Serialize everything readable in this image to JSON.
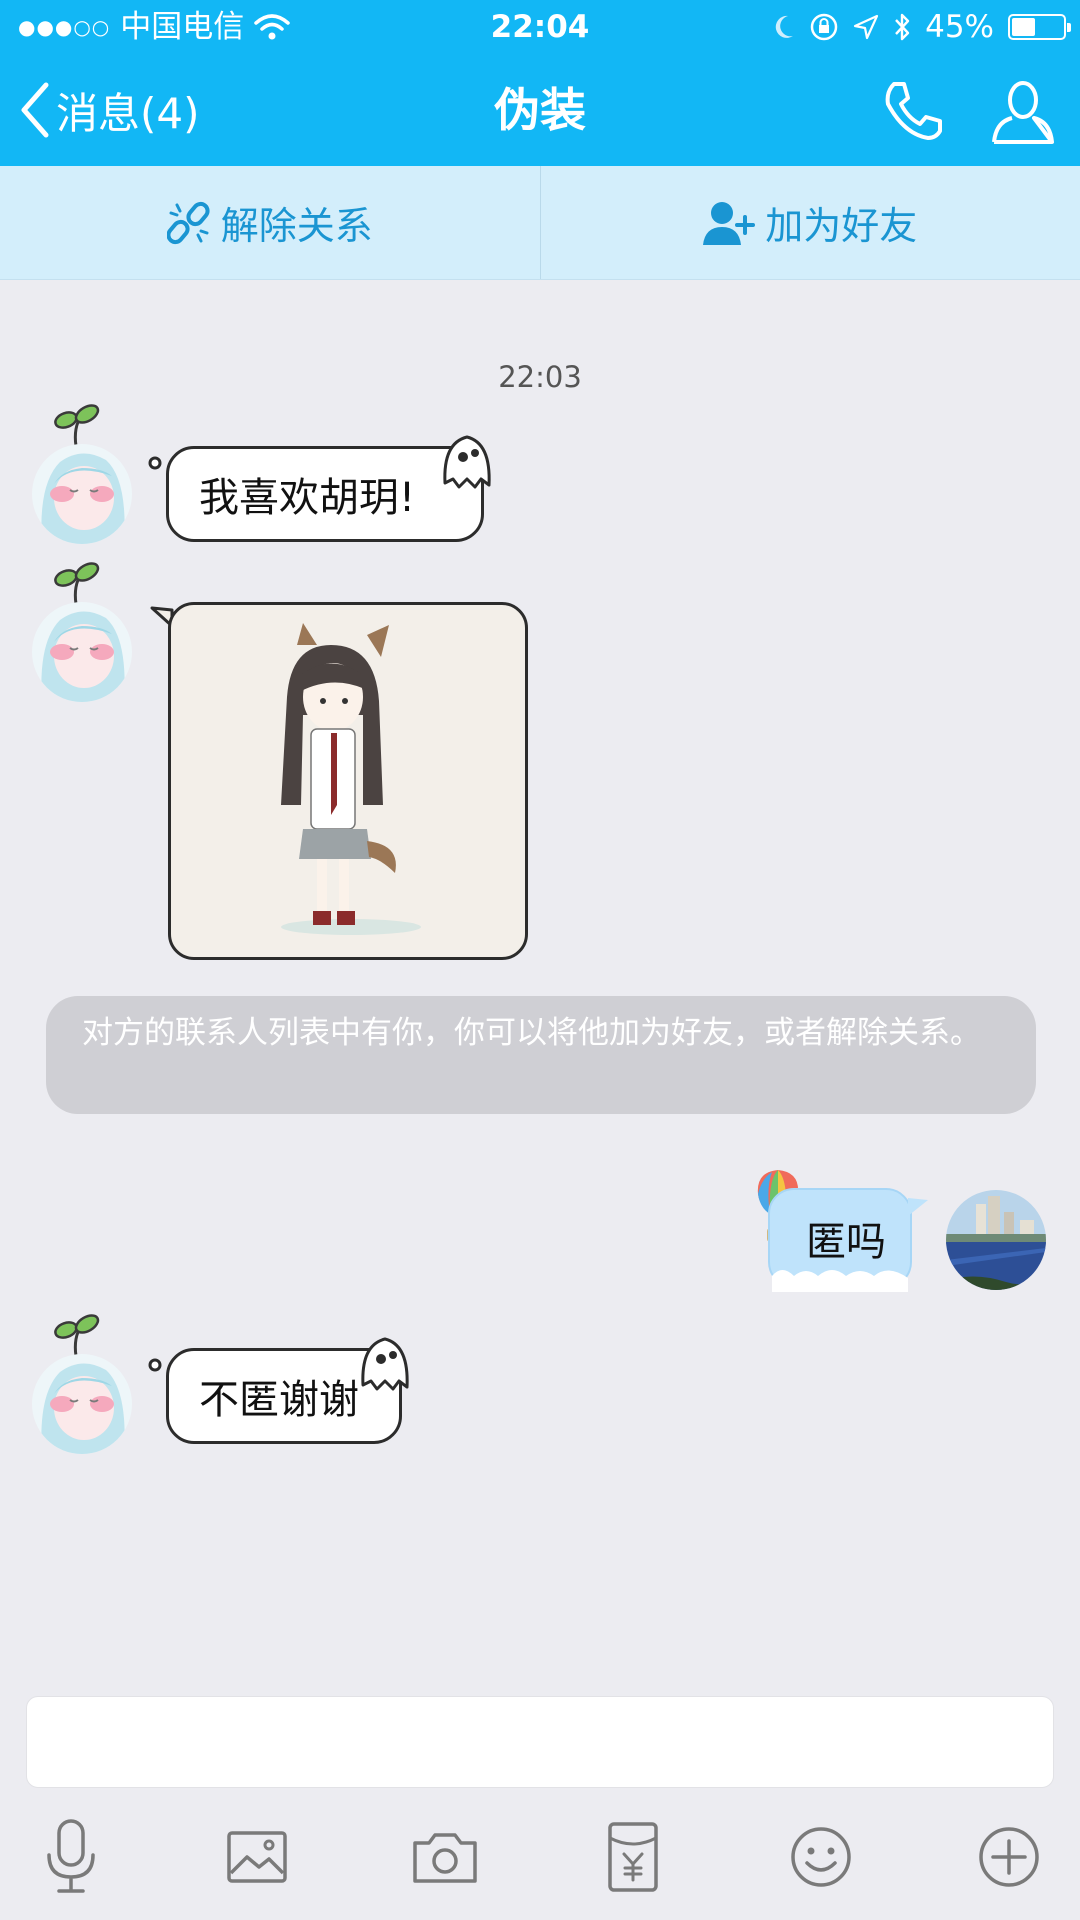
{
  "status_bar": {
    "signal": "●●●○○",
    "carrier": "中国电信",
    "time": "22:04",
    "battery": "45%",
    "battery_level": 0.45
  },
  "nav": {
    "back_label": "消息(4)",
    "title": "伪装"
  },
  "actions": {
    "unlink_label": "解除关系",
    "add_friend_label": "加为好友"
  },
  "chat": {
    "timestamp": "22:03",
    "messages": [
      {
        "from": "them",
        "type": "text",
        "text": "我喜欢胡玥!"
      },
      {
        "from": "them",
        "type": "image"
      },
      {
        "from": "system",
        "type": "notice",
        "text": "对方的联系人列表中有你，你可以将他加为好友，或者解除关系。"
      },
      {
        "from": "me",
        "type": "text",
        "text": "匿吗"
      },
      {
        "from": "them",
        "type": "text",
        "text": "不匿谢谢"
      }
    ]
  },
  "input": {
    "value": ""
  },
  "toolbar": {
    "items": [
      "mic-icon",
      "image-icon",
      "camera-icon",
      "red-packet-icon",
      "emoji-icon",
      "plus-icon"
    ]
  },
  "colors": {
    "header": "#12b7f5",
    "action_bar": "#d3eefb",
    "action_text": "#1a95d2",
    "background": "#ececf1",
    "notice": "#cfcfd4",
    "my_bubble": "#bfe3fb"
  }
}
